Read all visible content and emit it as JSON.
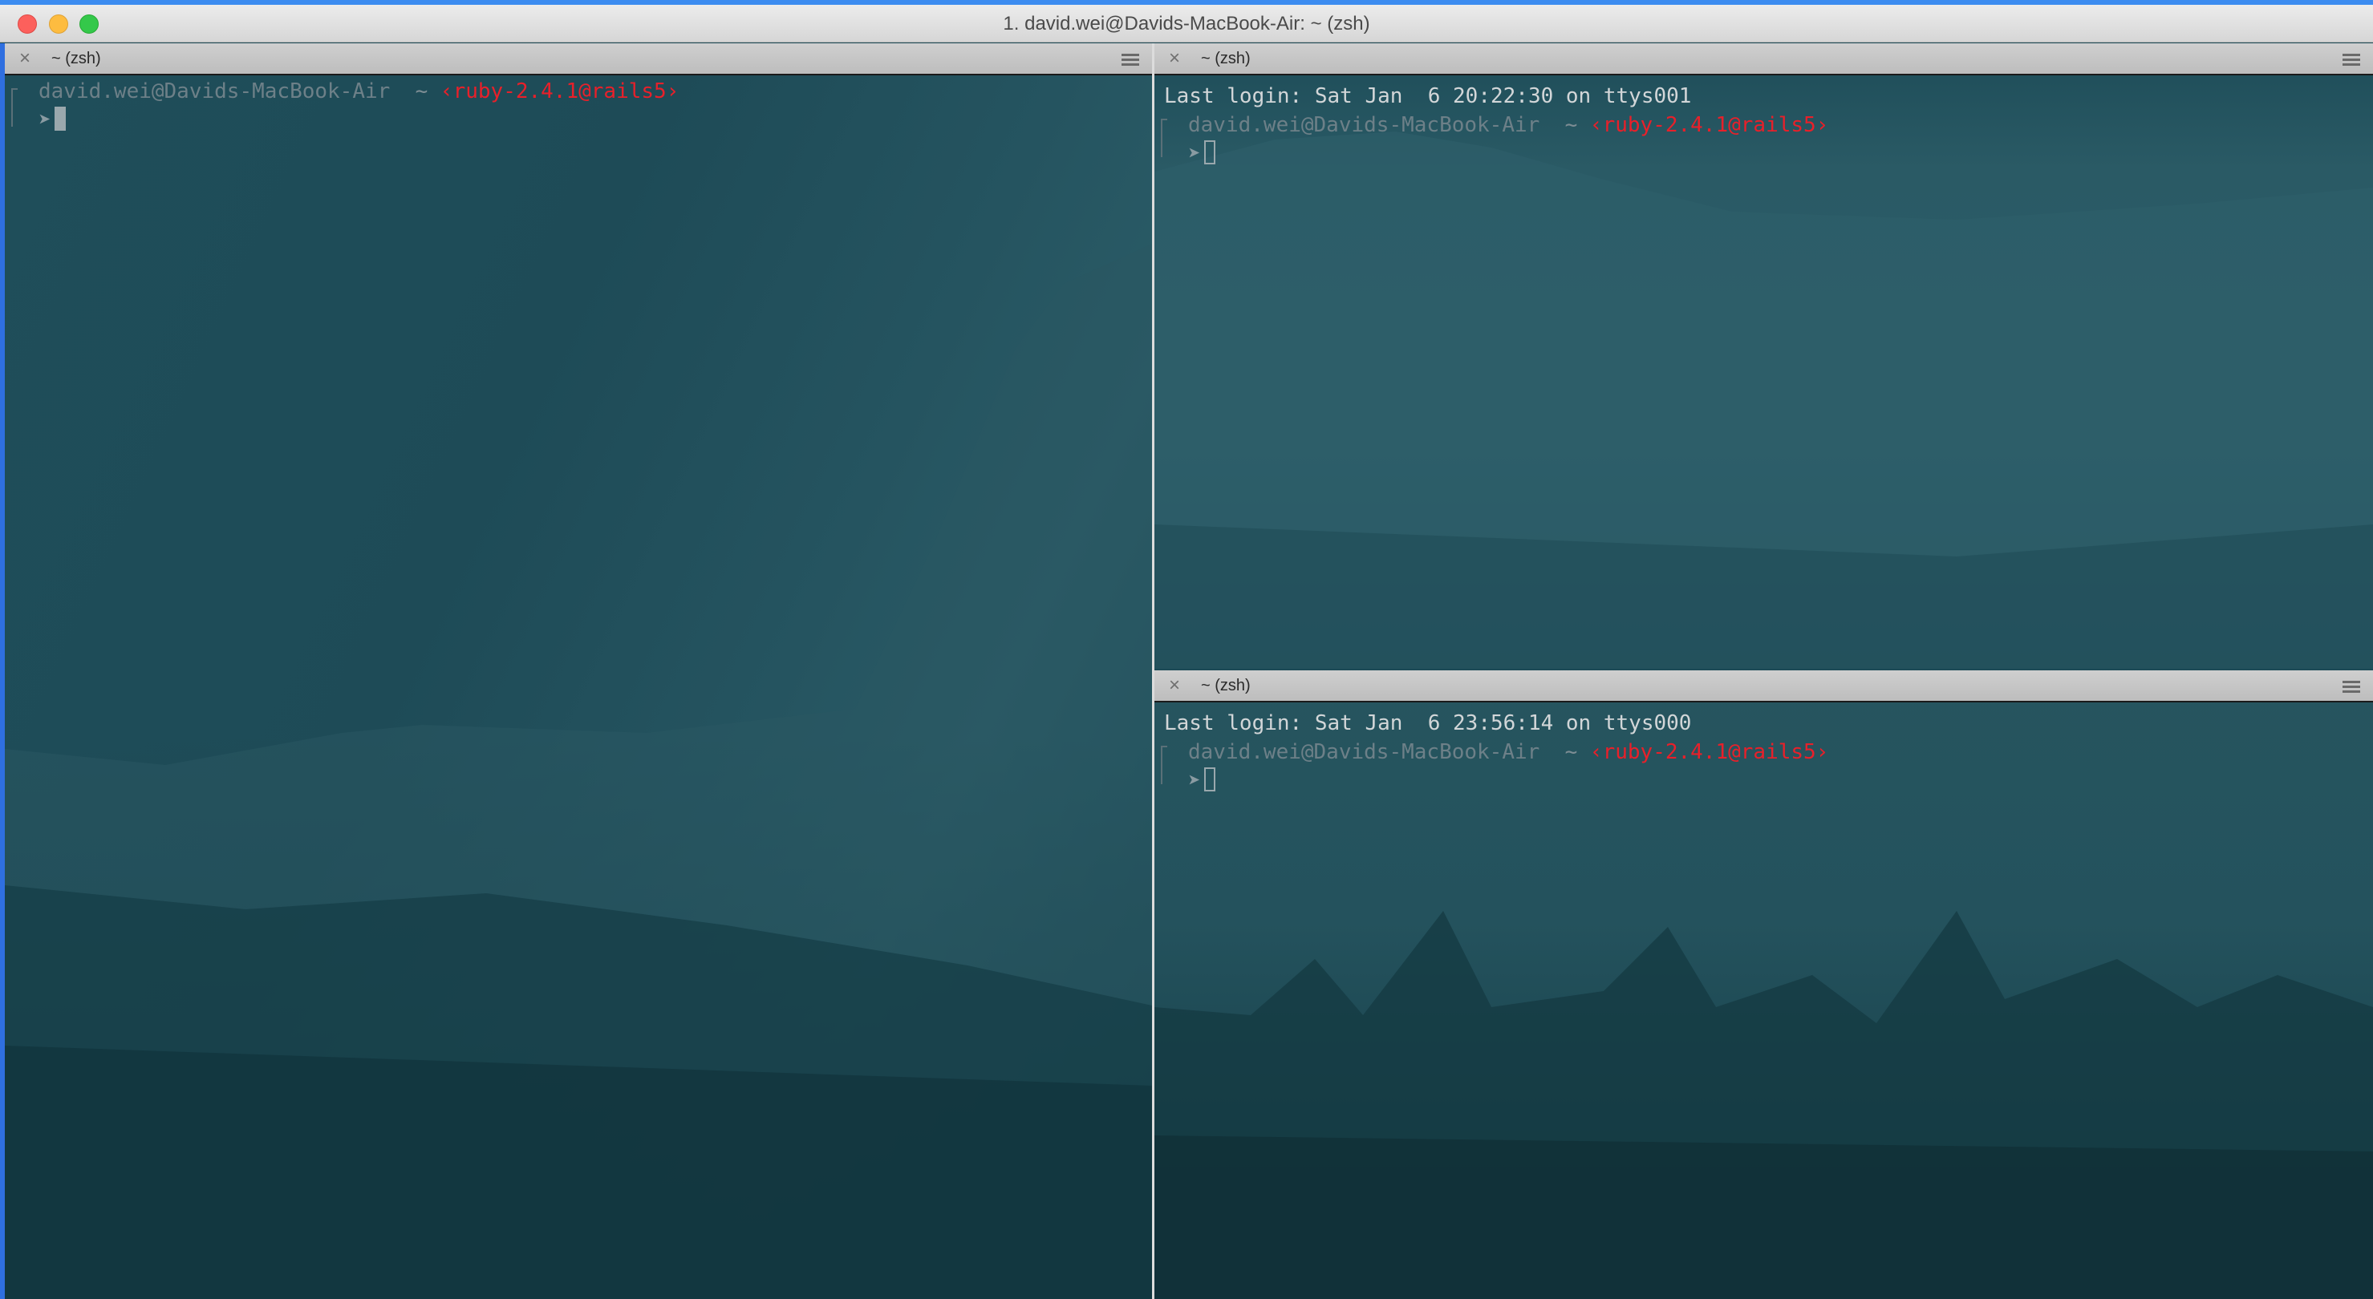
{
  "window": {
    "title": "1. david.wei@Davids-MacBook-Air: ~ (zsh)",
    "accent_color": "#3c8cf0"
  },
  "panes": [
    {
      "tab_title": "~ (zsh)",
      "close_icon": "close-icon",
      "menu_icon": "hamburger-menu-icon",
      "prompt_user": "david.wei@Davids-MacBook-Air",
      "prompt_dir": "~",
      "prompt_rvm": "‹ruby-2.4.1@rails5›",
      "prompt_arrow": "➤",
      "cursor": "block",
      "last_login": ""
    },
    {
      "tab_title": "~ (zsh)",
      "close_icon": "close-icon",
      "menu_icon": "hamburger-menu-icon",
      "last_login": "Last login: Sat Jan  6 20:22:30 on ttys001",
      "prompt_user": "david.wei@Davids-MacBook-Air",
      "prompt_dir": "~",
      "prompt_rvm": "‹ruby-2.4.1@rails5›",
      "prompt_arrow": "➤",
      "cursor": "hollow"
    },
    {
      "tab_title": "~ (zsh)",
      "close_icon": "close-icon",
      "menu_icon": "hamburger-menu-icon",
      "last_login": "Last login: Sat Jan  6 23:56:14 on ttys000",
      "prompt_user": "david.wei@Davids-MacBook-Air",
      "prompt_dir": "~",
      "prompt_rvm": "‹ruby-2.4.1@rails5›",
      "prompt_arrow": "➤",
      "cursor": "hollow"
    }
  ],
  "colors": {
    "background": "#1c4a56",
    "rvm_prompt": "#e8202a",
    "user_prompt": "#6d8088"
  }
}
